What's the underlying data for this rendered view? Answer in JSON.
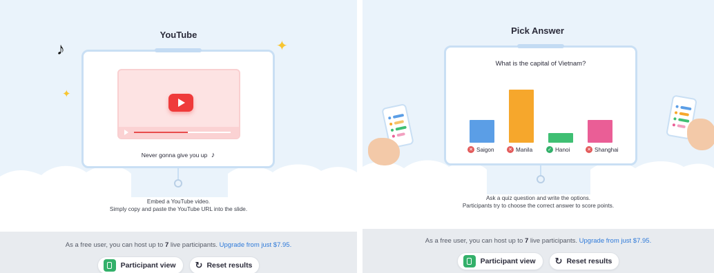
{
  "left_panel": {
    "title": "YouTube",
    "caption": "Never gonna give you up",
    "caption_icon": "music-note-icon",
    "description_line1": "Embed a YouTube video.",
    "description_line2": "Simply copy and paste the YouTube URL into the slide.",
    "video_progress": 0.56,
    "footer": {
      "prefix": "As a free user, you can host up to ",
      "count": "7",
      "suffix": " live participants. ",
      "link": "Upgrade from just $7.95."
    },
    "buttons": {
      "participant_view": "Participant view",
      "reset_results": "Reset results"
    }
  },
  "right_panel": {
    "title": "Pick Answer",
    "question": "What is the capital of Vietnam?",
    "description_line1": "Ask a quiz question and write the options.",
    "description_line2": "Participants try to choose the correct answer to score points.",
    "footer": {
      "prefix": "As a free user, you can host up to ",
      "count": "7",
      "suffix": " live participants. ",
      "link": "Upgrade from just $7.95."
    },
    "buttons": {
      "participant_view": "Participant view",
      "reset_results": "Reset results"
    }
  },
  "chart_data": {
    "type": "bar",
    "title": "What is the capital of Vietnam?",
    "categories": [
      "Saigon",
      "Manila",
      "Hanoi",
      "Shanghai"
    ],
    "values": [
      38,
      88,
      16,
      37
    ],
    "correct": [
      false,
      false,
      true,
      false
    ],
    "colors": [
      "#5b9ee6",
      "#f6a72c",
      "#3fbf73",
      "#ea5e96"
    ],
    "ylim": [
      0,
      100
    ]
  },
  "colors": {
    "sky": "#eaf3fb",
    "footer": "#e8ebef",
    "link": "#2f7ad9",
    "youtube_red": "#ef3b3b",
    "correct_green": "#33b06a",
    "wrong_red": "#e35a5a"
  }
}
